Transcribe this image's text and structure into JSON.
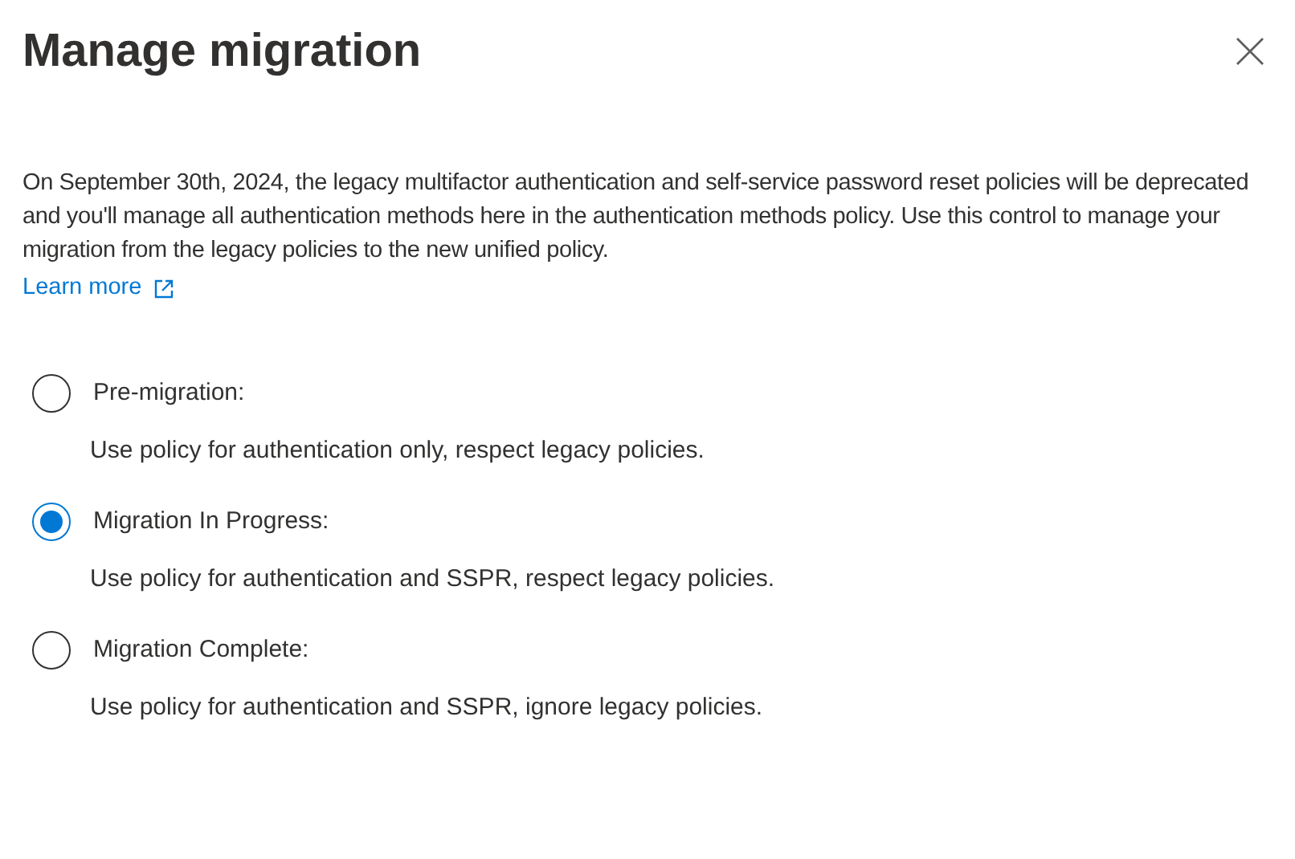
{
  "panel": {
    "title": "Manage migration",
    "description": "On September 30th, 2024, the legacy multifactor authentication and self-service password reset policies will be deprecated and you'll manage all authentication methods here in the authentication methods policy. Use this control to manage your migration from the legacy policies to the new unified policy.",
    "link": "Learn more"
  },
  "options": [
    {
      "label": "Pre-migration:",
      "description": "Use policy for authentication only, respect legacy policies.",
      "selected": false
    },
    {
      "label": "Migration In Progress:",
      "description": "Use policy for authentication and SSPR, respect legacy policies.",
      "selected": true
    },
    {
      "label": "Migration Complete:",
      "description": "Use policy for authentication and SSPR, ignore legacy policies.",
      "selected": false
    }
  ]
}
